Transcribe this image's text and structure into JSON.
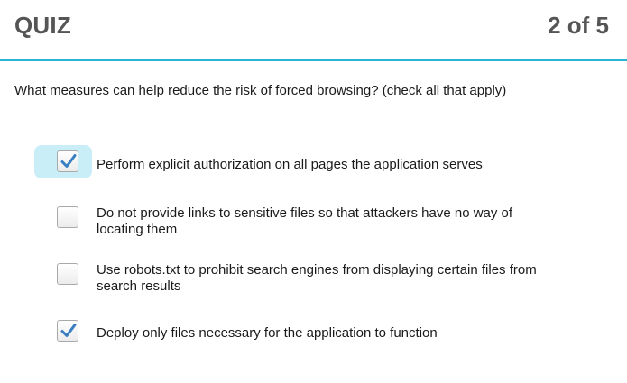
{
  "header": {
    "title": "QUIZ",
    "progress": "2 of 5"
  },
  "question": {
    "text": "What measures can help reduce the risk of forced browsing? (check all that apply)"
  },
  "options": [
    {
      "label": "Perform explicit authorization on all pages the application serves",
      "checked": true,
      "focused": true
    },
    {
      "label": "Do not provide links to sensitive files so that attackers have no way of locating them",
      "checked": false,
      "focused": false
    },
    {
      "label": "Use robots.txt to prohibit search engines from displaying certain files from search results",
      "checked": false,
      "focused": false
    },
    {
      "label": "Deploy only files necessary for the application to function",
      "checked": true,
      "focused": false
    }
  ],
  "colors": {
    "accent": "#2bb3d6",
    "focus_highlight": "#c9eef8",
    "checkmark": "#3a7fc1",
    "header_text": "#555555"
  },
  "icons": {
    "checked": "checkmark-icon"
  }
}
